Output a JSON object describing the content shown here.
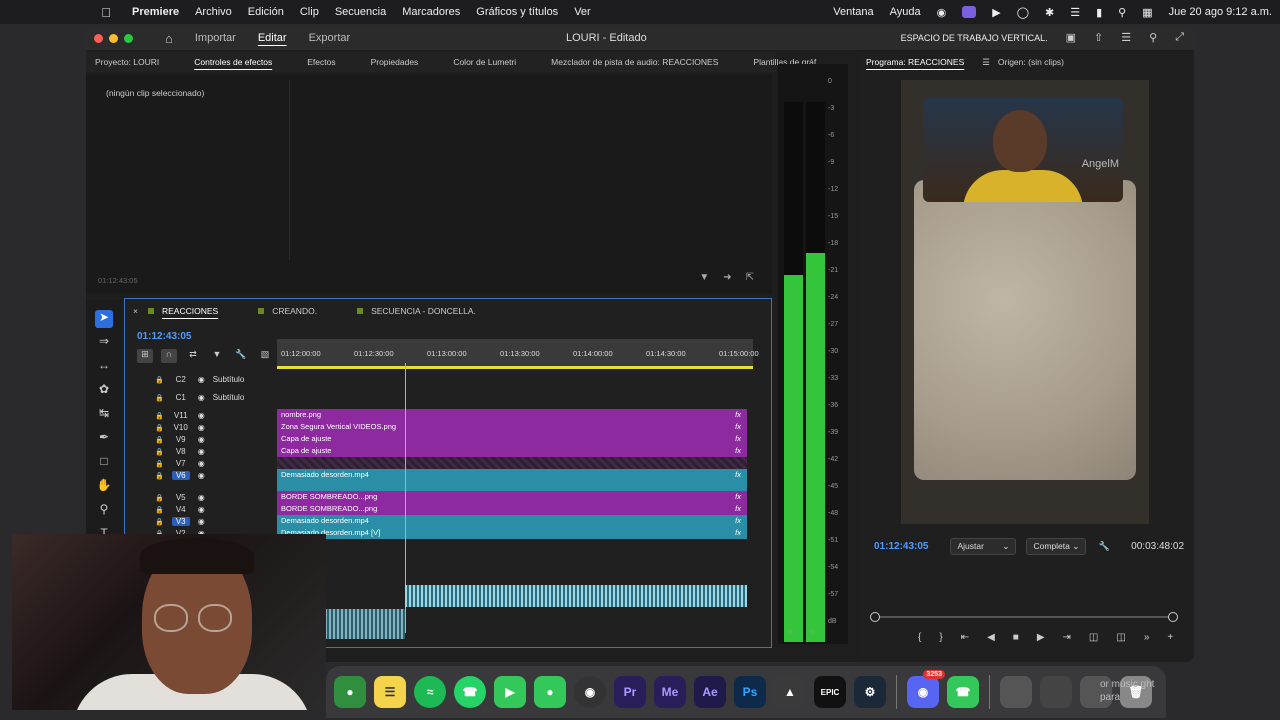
{
  "menubar": {
    "apple": "",
    "items": [
      "Premiere",
      "Archivo",
      "Edición",
      "Clip",
      "Secuencia",
      "Marcadores",
      "Gráficos y títulos",
      "Ver"
    ],
    "right_items": [
      "Ventana",
      "Ayuda"
    ],
    "clock": "Jue 20 ago 9:12 a.m."
  },
  "titlebar": {
    "tabs": [
      "Importar",
      "Editar",
      "Exportar"
    ],
    "title": "LOURI - Editado",
    "workspace": "ESPACIO DE TRABAJO  VERTICAL."
  },
  "left_panel": {
    "tabs": [
      "Proyecto: LOURI",
      "Controles de efectos",
      "Efectos",
      "Propiedades",
      "Color de Lumetri",
      "Mezclador de pista de audio: REACCIONES",
      "Plantillas de gráf"
    ],
    "no_clip": "(ningún clip seleccionado)",
    "timecode": "01:12:43:05"
  },
  "meter": {
    "scale": [
      "0",
      "-3",
      "-6",
      "-9",
      "-12",
      "-15",
      "-18",
      "-21",
      "-24",
      "-27",
      "-30",
      "-33",
      "-36",
      "-39",
      "-42",
      "-45",
      "-48",
      "-51",
      "-54",
      "-57",
      "dB"
    ],
    "labels": [
      "S",
      "S"
    ],
    "levels": [
      0.68,
      0.72
    ]
  },
  "program": {
    "tabs": [
      "Programa: REACCIONES",
      "Origen: (sin clips)"
    ],
    "timecode": "01:12:43:05",
    "fit": "Ajustar",
    "quality": "Completa",
    "duration": "00:03:48:02",
    "watermark": "AngelM"
  },
  "timeline": {
    "tabs": [
      "REACCIONES",
      "CREANDO.",
      "SECUENCIA - DONCELLA."
    ],
    "timecode": "01:12:43:05",
    "ticks": [
      "01:12:00:00",
      "01:12:30:00",
      "01:13:00:00",
      "01:13:30:00",
      "01:14:00:00",
      "01:14:30:00",
      "01:15:00:00"
    ],
    "tracks": [
      {
        "label": "C2",
        "name": "Subtítulo"
      },
      {
        "label": "C1",
        "name": "Subtítulo"
      },
      {
        "label": "V11",
        "clip": "nombre.png"
      },
      {
        "label": "V10",
        "clip": "Zona Segura Vertical VIDEOS.png"
      },
      {
        "label": "V9",
        "clip": "Capa de ajuste"
      },
      {
        "label": "V8",
        "clip": "Capa de ajuste"
      },
      {
        "label": "V7",
        "clip": ""
      },
      {
        "label": "V6",
        "clip": "Demasiado desorden.mp4"
      },
      {
        "label": "V5",
        "clip": "BORDE SOMBREADO...png"
      },
      {
        "label": "V4",
        "clip": "BORDE SOMBREADO...png"
      },
      {
        "label": "V3",
        "clip": "Demasiado desorden.mp4"
      },
      {
        "label": "V2",
        "clip": "Demasiado desorden.mp4 [V]"
      }
    ],
    "fx": "fx"
  },
  "dock": {
    "apps": [
      "Ps",
      "Pr",
      "Me",
      "Ae"
    ],
    "discord_badge": "3253",
    "trailing_text": "or músic ght para"
  }
}
